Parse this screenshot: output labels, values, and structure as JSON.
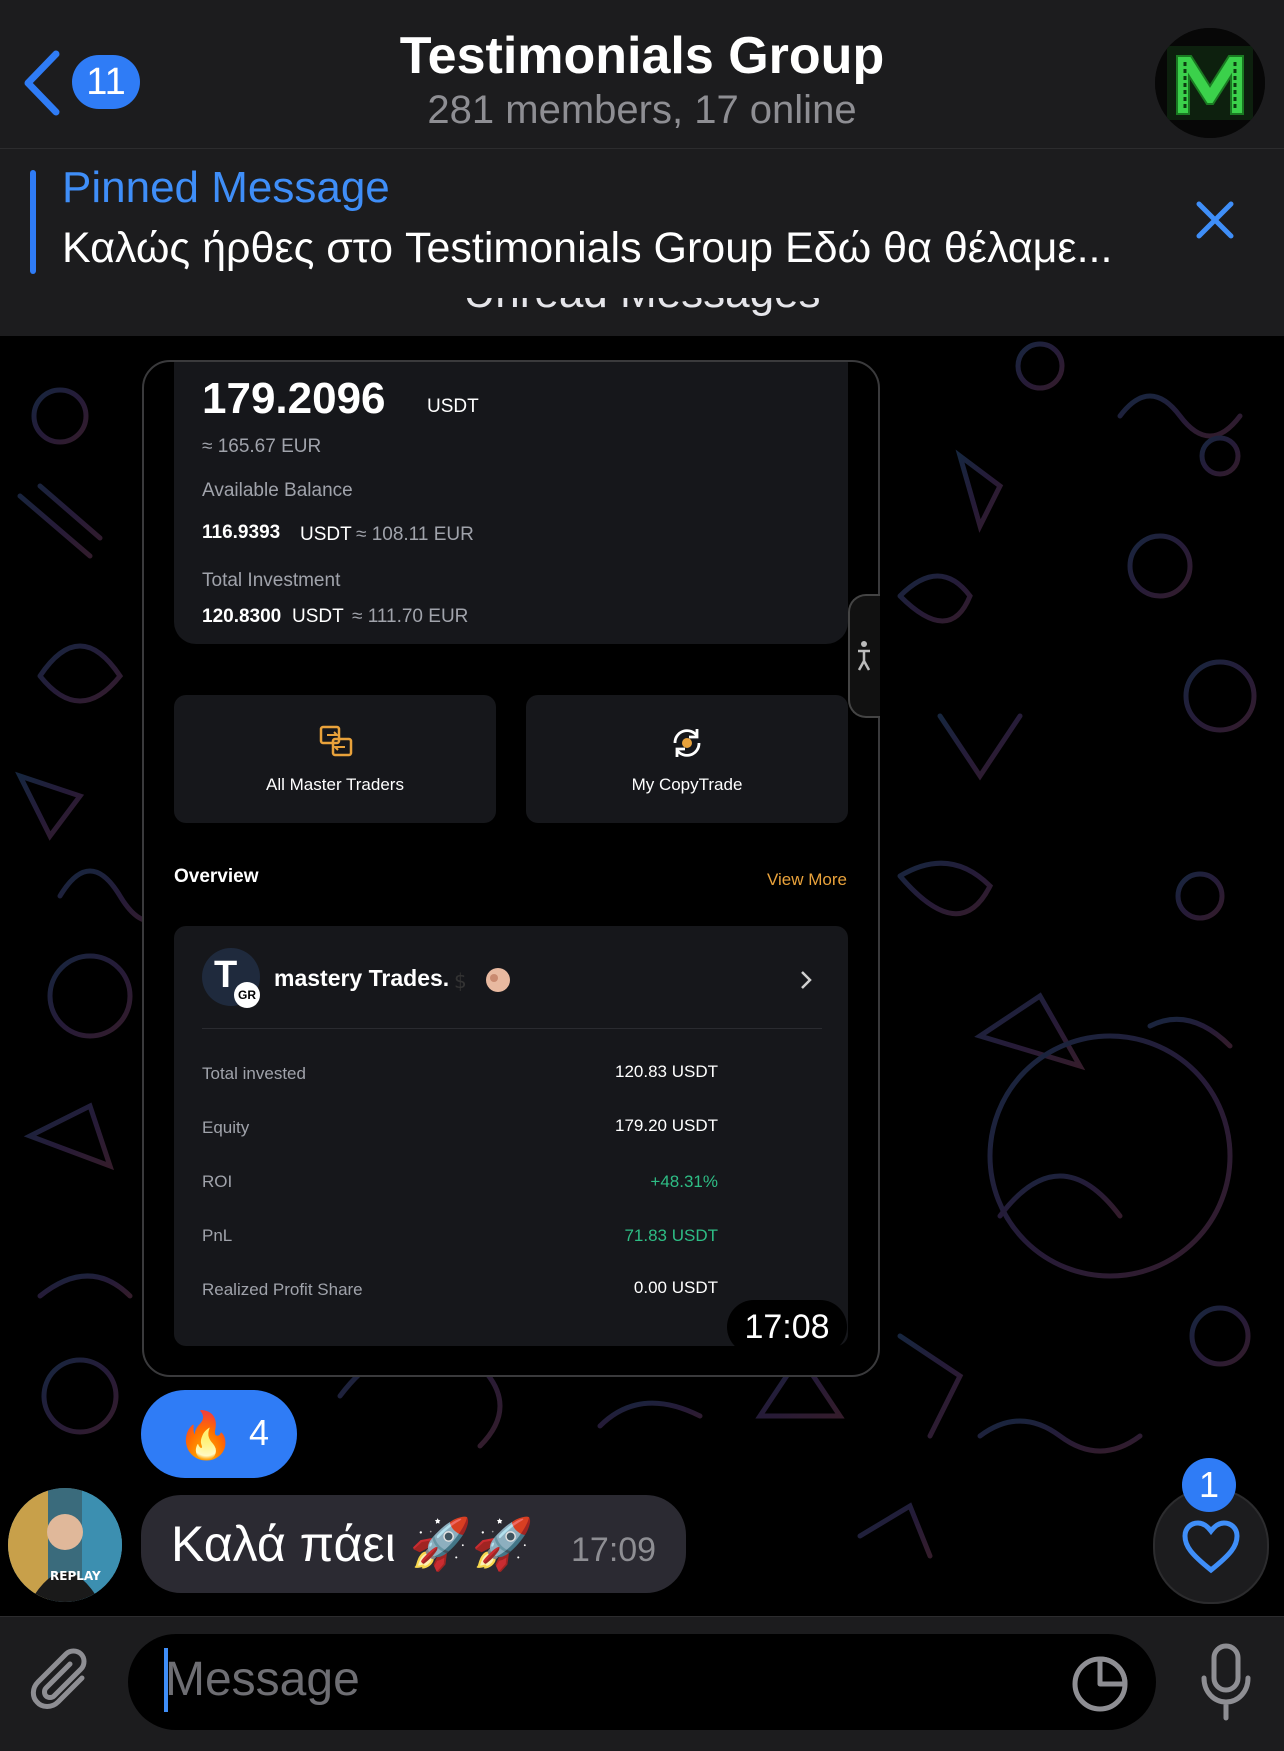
{
  "header": {
    "back_count": "11",
    "title": "Testimonials Group",
    "subtitle": "281 members, 17 online",
    "avatar_letter": "M"
  },
  "pinned": {
    "label": "Pinned Message",
    "text": "Καλώς ήρθες στο Testimonials Group Εδώ θα θέλαμε..."
  },
  "unread_divider": "Unread Messages",
  "screenshot": {
    "total_amount": "179.2096",
    "total_unit": "USDT",
    "total_eur": "≈ 165.67 EUR",
    "available_label": "Available Balance",
    "available_value": "116.9393",
    "available_unit": "USDT",
    "available_eur": "≈ 108.11 EUR",
    "investment_label": "Total Investment",
    "investment_value": "120.8300",
    "investment_unit": "USDT",
    "investment_eur": "≈ 111.70 EUR",
    "btn_all_masters": "All Master Traders",
    "btn_my_copytrade": "My CopyTrade",
    "overview_label": "Overview",
    "view_more": "View More",
    "trader_name": "mastery Trades.",
    "trader_badge": "GR",
    "trader_initial": "T",
    "rows": [
      {
        "label": "Total invested",
        "value": "120.83 USDT",
        "color": "white"
      },
      {
        "label": "Equity",
        "value": "179.20 USDT",
        "color": "white"
      },
      {
        "label": "ROI",
        "value": "+48.31%",
        "color": "green"
      },
      {
        "label": "PnL",
        "value": "71.83 USDT",
        "color": "green"
      },
      {
        "label": "Realized Profit Share",
        "value": "0.00 USDT",
        "color": "white"
      }
    ],
    "time": "17:08"
  },
  "reaction": {
    "emoji": "🔥",
    "count": "4"
  },
  "message": {
    "text": "Καλά πάει 🚀🚀",
    "time": "17:09"
  },
  "scroll_badge": "1",
  "input": {
    "placeholder": "Message"
  },
  "colors": {
    "accent": "#2f7cf6",
    "green": "#2ebd85",
    "orange": "#e9a23b"
  }
}
